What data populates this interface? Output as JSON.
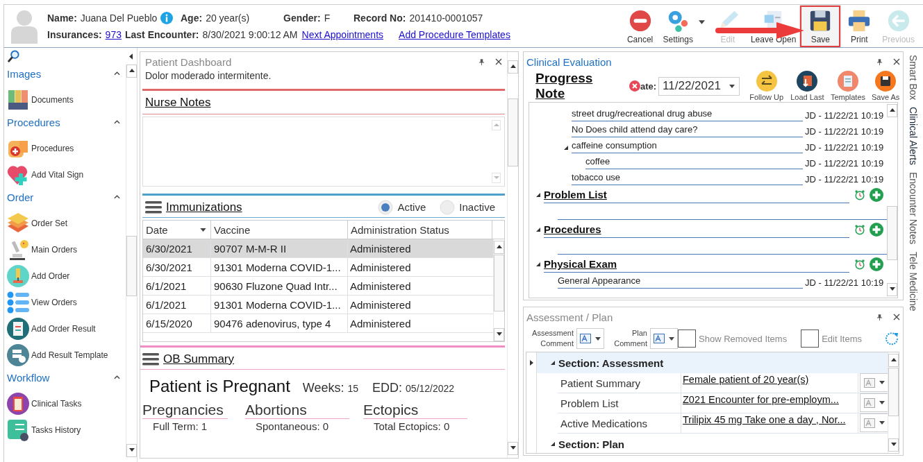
{
  "patient": {
    "line_1": [
      {
        "label": "Name:",
        "value": "Juana Del Pueblo",
        "kind": "info"
      },
      {
        "label": "Age:",
        "value": "20 year(s)",
        "kind": "text"
      },
      {
        "label": "Gender:",
        "value": "F",
        "kind": "text"
      },
      {
        "label": "Record No:",
        "value": "201410-0001057",
        "kind": "text"
      }
    ],
    "line_2": [
      {
        "label": "Insurances:",
        "value": "973",
        "kind": "link"
      },
      {
        "label": "Last Encounter:",
        "value": "8/30/2021 9:00:12 AM",
        "kind": "text"
      }
    ],
    "links": [
      "Next Appointments",
      "Add Procedure Templates"
    ]
  },
  "toolbar": [
    {
      "label": "Cancel",
      "kind": "cancel",
      "disabled": false,
      "menu": false,
      "highlighted": false
    },
    {
      "label": "Settings",
      "kind": "settings",
      "disabled": false,
      "menu": true,
      "highlighted": false
    },
    {
      "label": "Edit",
      "kind": "edit",
      "disabled": true,
      "menu": false,
      "highlighted": false
    },
    {
      "label": "Leave Open",
      "kind": "leave_open",
      "disabled": false,
      "menu": false,
      "highlighted": false
    },
    {
      "label": "Save",
      "kind": "save",
      "disabled": false,
      "menu": false,
      "highlighted": true
    },
    {
      "label": "Print",
      "kind": "print",
      "disabled": false,
      "menu": false,
      "highlighted": false
    },
    {
      "label": "Previous",
      "kind": "previous",
      "disabled": true,
      "menu": false,
      "highlighted": false
    }
  ],
  "sidebar": {
    "groups": [
      {
        "title": "Images",
        "expanded": true,
        "items": [
          {
            "label": "Documents",
            "kind": "binders"
          }
        ]
      },
      {
        "title": "Procedures",
        "expanded": true,
        "items": [
          {
            "label": "Procedures",
            "kind": "bandage"
          },
          {
            "label": "Add Vital Sign",
            "kind": "heart"
          }
        ]
      },
      {
        "title": "Order",
        "expanded": true,
        "items": [
          {
            "label": "Order Set",
            "kind": "layers"
          },
          {
            "label": "Main Orders",
            "kind": "microscope"
          },
          {
            "label": "Add Order",
            "kind": "microscope_round"
          },
          {
            "label": "View Orders",
            "kind": "list"
          },
          {
            "label": "Add Order Result",
            "kind": "clipboard_round"
          },
          {
            "label": "Add Result Template",
            "kind": "server"
          }
        ]
      },
      {
        "title": "Workflow",
        "expanded": true,
        "items": [
          {
            "label": "Clinical Tasks",
            "kind": "clipboard_purple"
          },
          {
            "label": "Tasks History",
            "kind": "checklist"
          }
        ]
      }
    ]
  },
  "dashboard": {
    "title": "Patient Dashboard",
    "note": "Dolor moderado intermitente.",
    "nurse_notes": {
      "title": "Nurse Notes"
    },
    "immunizations": {
      "title": "Immunizations",
      "filters": [
        {
          "label": "Active",
          "selected": true
        },
        {
          "label": "Inactive",
          "selected": false
        }
      ],
      "table": {
        "columns": [
          "Date",
          "Vaccine",
          "Administration Status"
        ],
        "rows": [
          {
            "cells": [
              "6/30/2021",
              "90707 M-M-R II",
              "Administered"
            ],
            "selected": true
          },
          {
            "cells": [
              "6/30/2021",
              "91301 Moderna COVID-1...",
              "Administered"
            ],
            "selected": false
          },
          {
            "cells": [
              "6/1/2021",
              "90630 Fluzone Quad Intr...",
              "Administered"
            ],
            "selected": false
          },
          {
            "cells": [
              "6/1/2021",
              "91301 Moderna COVID-1...",
              "Administered"
            ],
            "selected": false
          },
          {
            "cells": [
              "6/15/2020",
              "90476 adenovirus, type 4",
              "Administered"
            ],
            "selected": false
          }
        ]
      }
    },
    "ob_summary": {
      "title": "OB Summary",
      "status": "Patient is Pregnant",
      "weeks_label": "Weeks:",
      "weeks": "15",
      "edd_label": "EDD:",
      "edd": "05/12/2022",
      "groups": [
        {
          "title": "Pregnancies",
          "detail": "Full Term: 1"
        },
        {
          "title": "Abortions",
          "detail": "Spontaneous: 0"
        },
        {
          "title": "Ectopics",
          "detail": "Total Ectopics: 0"
        }
      ]
    }
  },
  "clinical_evaluation": {
    "title": "Clinical Evaluation",
    "note_title": "Progress Note",
    "date_label": "ate:",
    "date": "11/22/2021",
    "actions": [
      {
        "label": "Follow Up",
        "kind": "follow_up"
      },
      {
        "label": "Load Last",
        "kind": "load_last"
      },
      {
        "label": "Templates",
        "kind": "templates"
      },
      {
        "label": "Save As",
        "kind": "save_as"
      }
    ],
    "history_items": [
      {
        "label": "street drug/recreational drug abuse",
        "stamp": "JD - 11/22/21 10:19"
      },
      {
        "label": "No Does child attend day care?",
        "stamp": "JD - 11/22/21 10:19"
      },
      {
        "label": "caffeine consumption",
        "stamp": "JD - 11/22/21 10:19",
        "expanded": true,
        "children": [
          {
            "label": "coffee",
            "stamp": "JD - 11/22/21 10:19"
          }
        ]
      },
      {
        "label": "tobacco use",
        "stamp": "JD - 11/22/21 10:19"
      }
    ],
    "sections": [
      {
        "title": "Problem List",
        "expanded": true
      },
      {
        "title": "Procedures",
        "expanded": true
      },
      {
        "title": "Physical Exam",
        "expanded": true,
        "items": [
          {
            "label": "General Appearance",
            "stamp": "JD - 11/22/21 10:19"
          }
        ]
      }
    ]
  },
  "assessment_plan": {
    "title": "Assessment / Plan",
    "comment_labels": [
      "Assessment Comment",
      "Plan Comment"
    ],
    "options": [
      {
        "label": "Show Removed Items",
        "checked": false
      },
      {
        "label": "Edit Items",
        "checked": false
      }
    ],
    "sections": [
      {
        "title": "Section: Assessment",
        "expanded": true,
        "selected": true,
        "rows": [
          {
            "label": "Patient Summary",
            "value": "Female patient of 20 year(s)"
          },
          {
            "label": "Problem List",
            "value": "Z021 Encounter for pre-employm..."
          },
          {
            "label": "Active Medications",
            "value": "Trilipix 45 mg Take one a day , Nor..."
          }
        ]
      },
      {
        "title": "Section: Plan",
        "expanded": true,
        "selected": false
      }
    ]
  },
  "side_tabs": [
    {
      "label": "Smart Box",
      "selected": false
    },
    {
      "label": "Clinical Alerts",
      "selected": true
    },
    {
      "label": "Encounter Notes",
      "selected": false
    },
    {
      "label": "Tele Medicine",
      "selected": false
    }
  ]
}
